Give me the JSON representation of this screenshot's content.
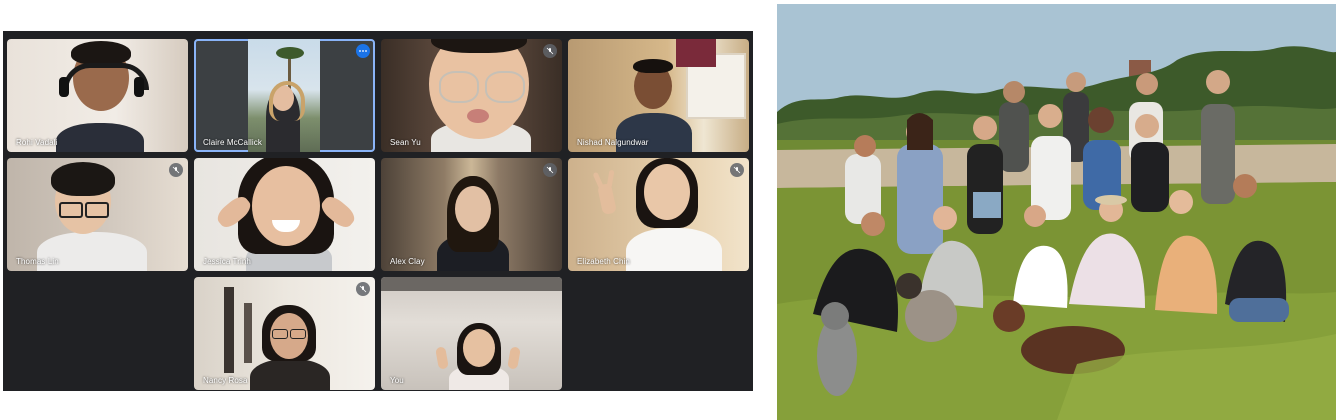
{
  "call": {
    "participants": [
      {
        "name": "Rohi Vadali",
        "muted": false
      },
      {
        "name": "Claire McCallick",
        "muted": false,
        "active": true
      },
      {
        "name": "Sean Yu",
        "muted": true
      },
      {
        "name": "Nishad Nalgundwar",
        "muted": false
      },
      {
        "name": "Thomas Lin",
        "muted": true
      },
      {
        "name": "Jessica Trinh",
        "muted": false
      },
      {
        "name": "Alex Clay",
        "muted": true
      },
      {
        "name": "Elizabeth Chin",
        "muted": true
      },
      {
        "name": "Nancy Rosa",
        "muted": true
      },
      {
        "name": "You",
        "muted": false
      }
    ]
  },
  "colors": {
    "call_background": "#202124",
    "tile_background": "#3c4043",
    "active_outline": "#8ab4f8",
    "more_button": "#1a73e8",
    "grass": "#6f8a34",
    "sky": "#a9c3d3"
  },
  "icons": {
    "mic_off": "mic-off-icon",
    "more": "more-options-icon"
  }
}
